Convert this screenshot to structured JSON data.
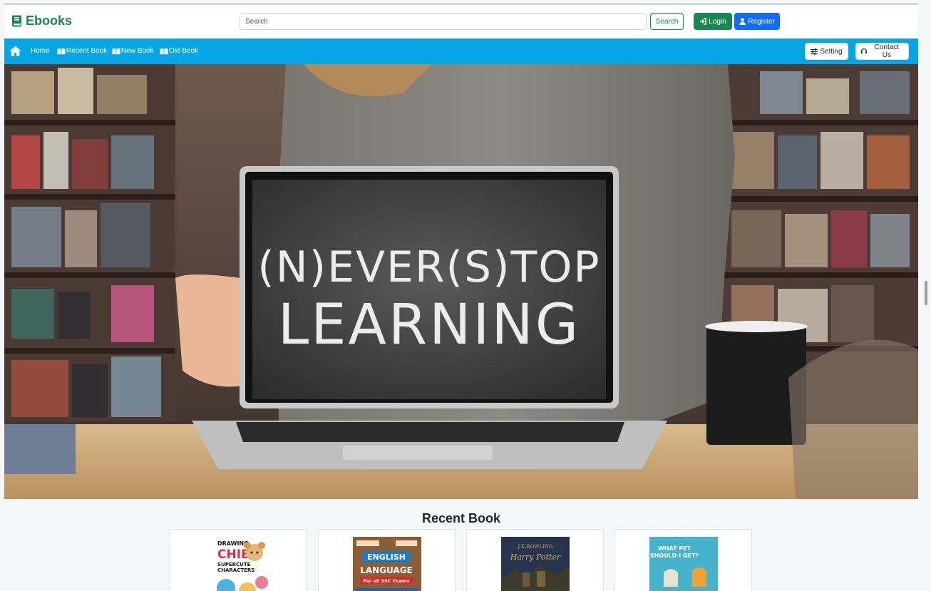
{
  "header": {
    "brand": "Ebooks",
    "search_placeholder": "Search",
    "search_button": "Search",
    "login_button": "Login",
    "register_button": "Register"
  },
  "navbar": {
    "home": "Home",
    "recent_book": "Recent Book",
    "new_book": "New Book",
    "old_book": "Old Book",
    "setting": "Setting",
    "contact_us": "Contact Us"
  },
  "hero": {
    "line1": "(N)EVER(S)TOP",
    "line2": "LEARNING"
  },
  "recent_section": {
    "title": "Recent Book",
    "books": [
      {
        "cover_lines": [
          "DRAWING",
          "CHIBI",
          "SUPERCUTE",
          "CHARACTERS"
        ]
      },
      {
        "cover_lines": [
          "ENGLISH",
          "LANGUAGE",
          "For all SSC Exams"
        ]
      },
      {
        "cover_lines": [
          "J.K.ROWLING",
          "Harry Potter"
        ]
      },
      {
        "cover_lines": [
          "WHAT PET",
          "SHOULD I GET?"
        ]
      }
    ]
  },
  "colors": {
    "brand_green": "#198754",
    "navbar_blue": "#05a6e3",
    "register_blue": "#0d6efd"
  },
  "icons": [
    "book-icon",
    "sign-in-icon",
    "user-icon",
    "home-icon",
    "book-open-icon",
    "sliders-icon",
    "headset-icon"
  ]
}
